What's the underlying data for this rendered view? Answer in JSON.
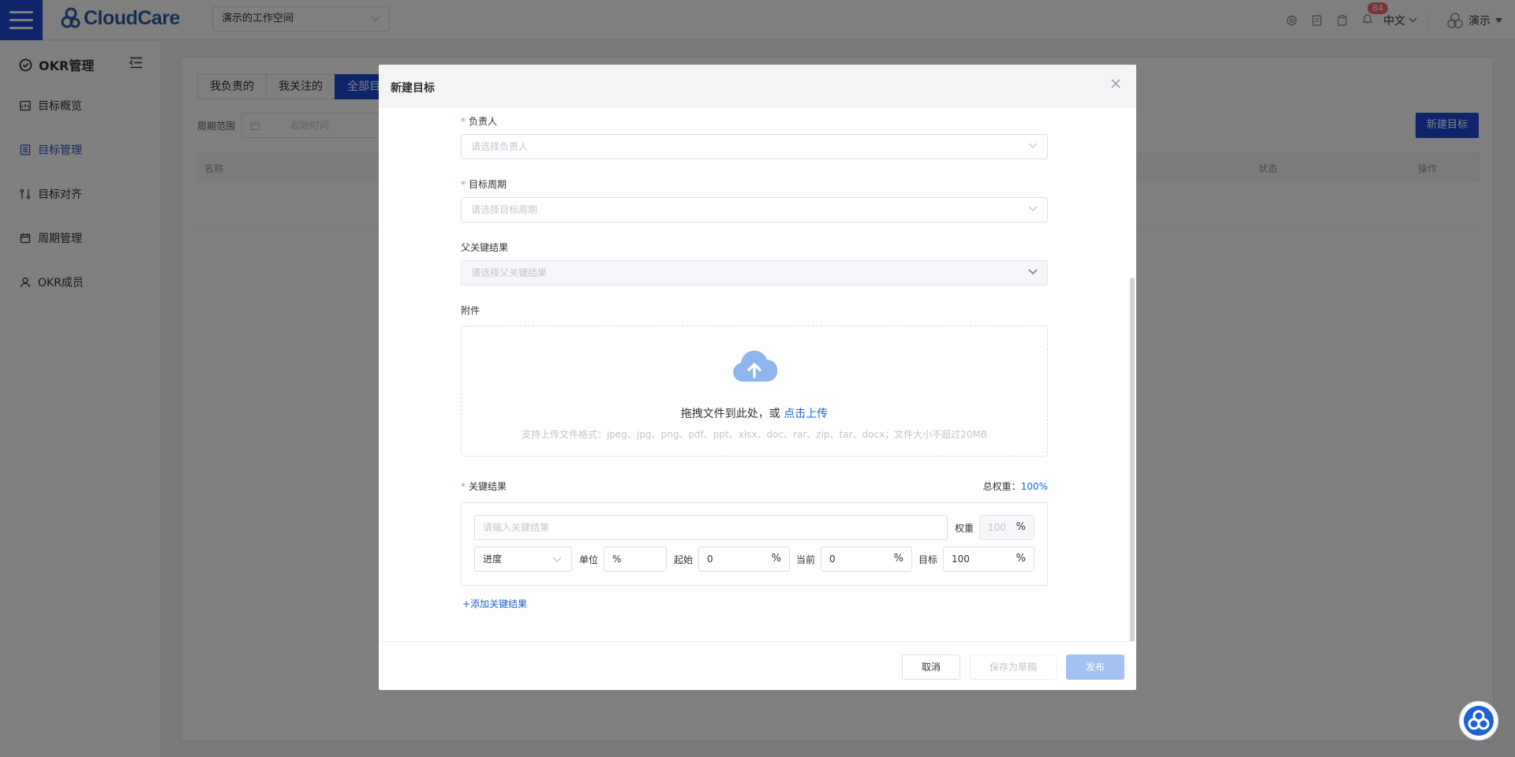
{
  "topbar": {
    "brand": "CloudCare",
    "workspace": "演示的工作空间",
    "notification_count": "84",
    "language": "中文",
    "user": "演示"
  },
  "sidebar": {
    "title": "OKR管理",
    "items": [
      {
        "label": "目标概览",
        "icon": "overview-icon"
      },
      {
        "label": "目标管理",
        "icon": "list-icon",
        "active": true
      },
      {
        "label": "目标对齐",
        "icon": "align-icon"
      },
      {
        "label": "周期管理",
        "icon": "calendar-icon"
      },
      {
        "label": "OKR成员",
        "icon": "user-icon"
      }
    ]
  },
  "main": {
    "tabs": [
      "我负责的",
      "我关注的",
      "全部目"
    ],
    "period_label": "周期范围",
    "period_start_placeholder": "起始时间",
    "new_goal_button": "新建目标",
    "columns": {
      "name": "名称",
      "status": "状态",
      "action": "操作"
    }
  },
  "dialog": {
    "title": "新建目标",
    "owner": {
      "label": "负责人",
      "placeholder": "请选择负责人"
    },
    "period": {
      "label": "目标周期",
      "placeholder": "请选择目标周期"
    },
    "parent_kr": {
      "label": "父关键结果",
      "placeholder": "请选择父关键结果"
    },
    "attachment": {
      "label": "附件",
      "drag_text": "拖拽文件到此处，或",
      "click_upload": "点击上传",
      "hint": "支持上传文件格式：jpeg、jpg、png、pdf、ppt、xlsx、doc、rar、zip、tar、docx；文件大小不超过20MB"
    },
    "key_results": {
      "label": "关键结果",
      "total_weight_label": "总权重：",
      "total_weight_value": "100%",
      "kr_placeholder": "请输入关键结果",
      "weight_label": "权重",
      "weight_value": "100",
      "percent": "%",
      "type_value": "进度",
      "unit_label": "单位",
      "unit_value": "%",
      "start_label": "起始",
      "start_value": "0",
      "current_label": "当前",
      "current_value": "0",
      "target_label": "目标",
      "target_value": "100",
      "add_button": "+添加关键结果"
    },
    "footer": {
      "cancel": "取消",
      "save_draft": "保存为草稿",
      "publish": "发布"
    }
  },
  "colors": {
    "primary": "#1d4bd6",
    "link": "#1d62d6",
    "required": "#f56c6c",
    "upload_icon": "#8fb5ee"
  }
}
